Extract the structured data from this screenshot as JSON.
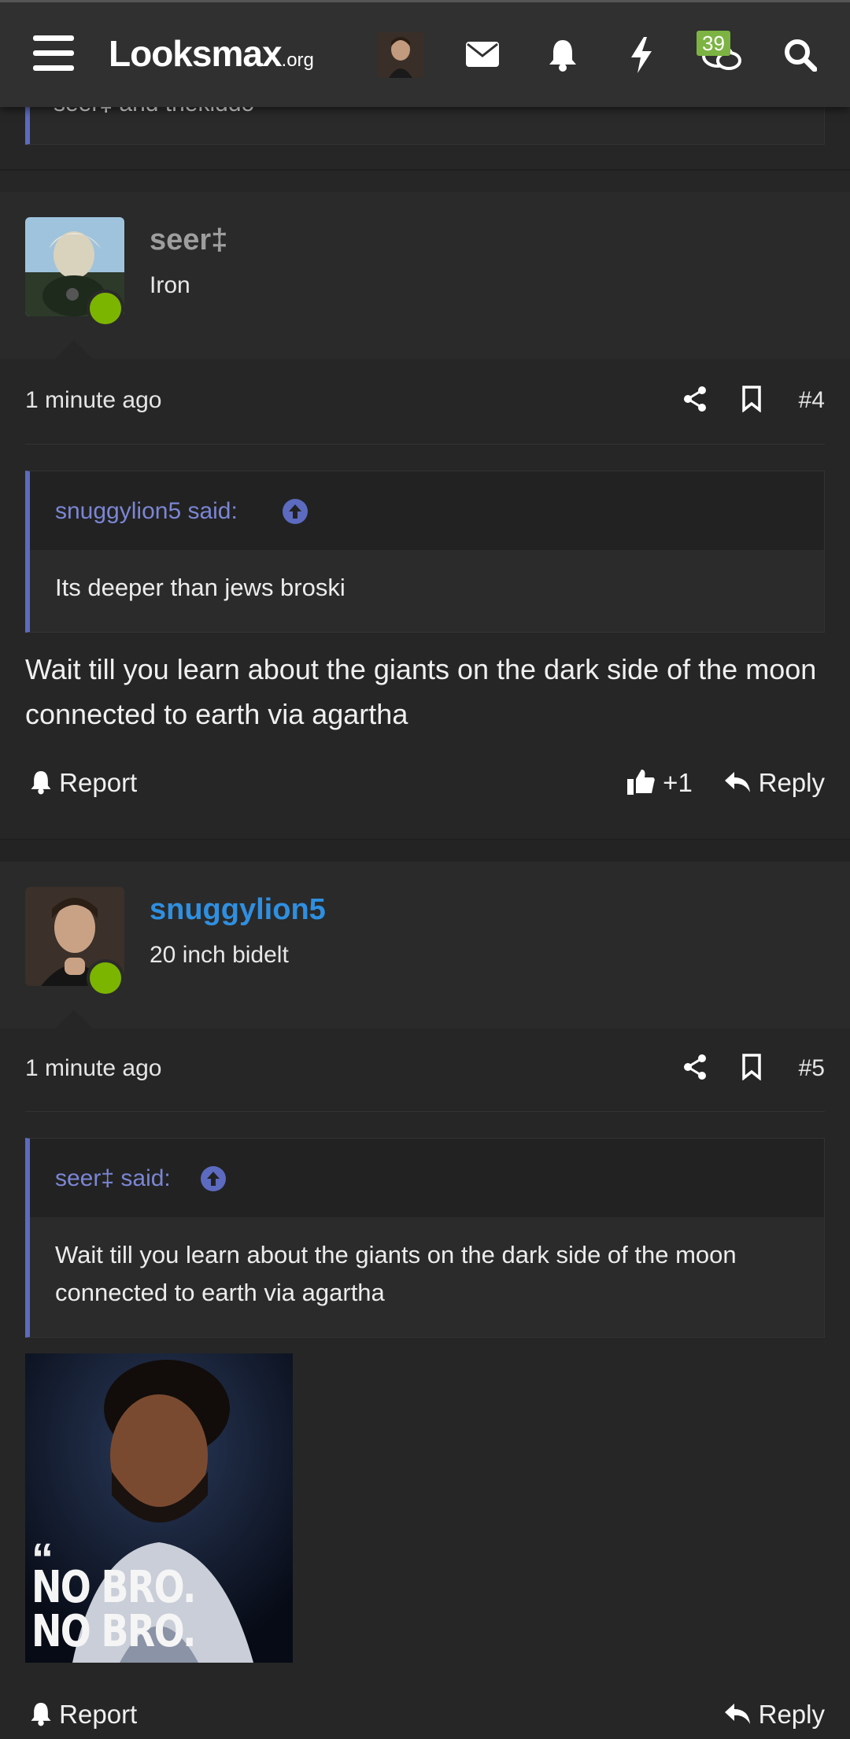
{
  "header": {
    "logo_main": "Looksmax",
    "logo_suffix": ".org",
    "badge_count": "39",
    "icons": [
      "menu-icon",
      "avatar",
      "envelope-icon",
      "bell-icon",
      "lightning-icon",
      "chat-icon",
      "search-icon"
    ]
  },
  "previous_quote": {
    "text": "seer‡ and thekiddo"
  },
  "posts": [
    {
      "username": "seer‡",
      "username_color": "#9e9e9e",
      "user_title": "Iron",
      "time": "1 minute ago",
      "number": "#4",
      "quote_author": "snuggylion5 said:",
      "quote_text": "Its deeper than jews broski",
      "body": "Wait till you learn about the giants on the dark side of the moon connected to earth via agartha",
      "report_label": "Report",
      "like_count": "+1",
      "reply_label": "Reply"
    },
    {
      "username": "snuggylion5",
      "username_color": "#2f8fe0",
      "user_title": "20 inch bidelt",
      "time": "1 minute ago",
      "number": "#5",
      "quote_author": "seer‡ said:",
      "quote_text": "Wait till you learn about the giants on the dark side of the moon connected to earth via agartha",
      "image_caption": "NO BRO. NO BRO.",
      "report_label": "Report",
      "reply_label": "Reply"
    }
  ]
}
